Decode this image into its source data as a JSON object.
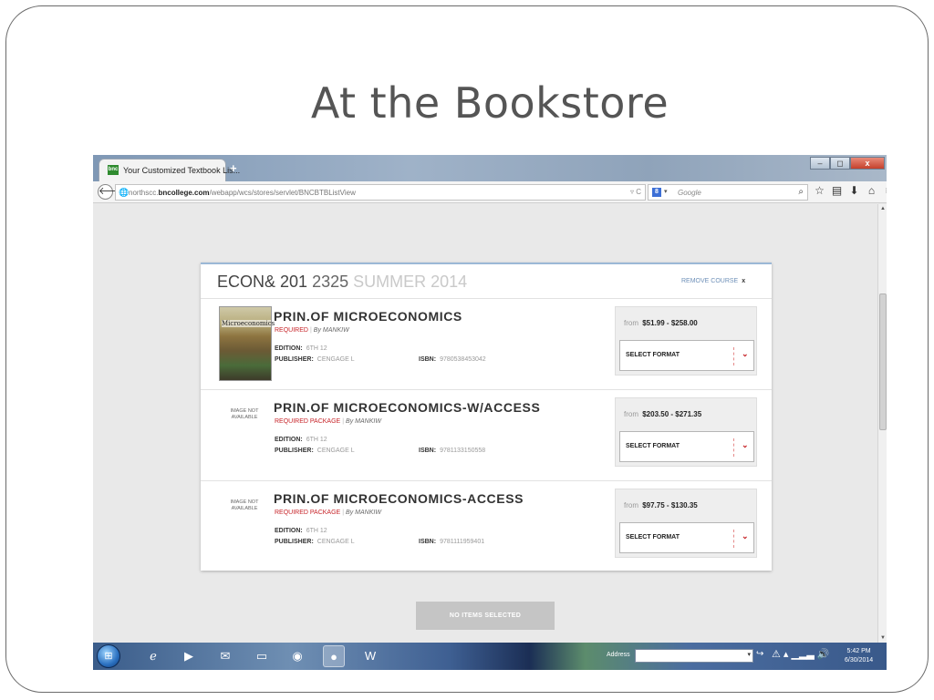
{
  "slide": {
    "title": "At the Bookstore"
  },
  "browser": {
    "tab_title": "Your Customized Textbook Lis...",
    "tab_favicon": "bnc",
    "new_tab": "+",
    "window_buttons": {
      "minimize": "–",
      "maximize": "◻",
      "close": "x"
    },
    "url_prefix": "northscc.",
    "url_domain": "bncollege.com",
    "url_path": "/webapp/wcs/stores/servlet/BNCBTBListView",
    "url_icons": "▿ C",
    "search_engine_icon": "8",
    "search_placeholder": "Google",
    "toolbar_icons": [
      "search-icon",
      "star-icon",
      "clipboard-icon",
      "download-icon",
      "home-icon",
      "menu-icon"
    ]
  },
  "course": {
    "name": "ECON& 201",
    "number": "2325",
    "term": "SUMMER 2014",
    "remove_label": "REMOVE COURSE",
    "remove_x": "x"
  },
  "books": [
    {
      "title": "PRIN.OF MICROECONOMICS",
      "requirement": "REQUIRED",
      "author": "By MANKIW",
      "edition_label": "EDITION:",
      "edition": "6TH 12",
      "publisher_label": "PUBLISHER:",
      "publisher": "CENGAGE L",
      "isbn_label": "ISBN:",
      "isbn": "9780538453042",
      "image": "Microeconomics",
      "price_from": "from",
      "price_range": "$51.99 - $258.00",
      "select_label": "SELECT FORMAT"
    },
    {
      "title": "PRIN.OF MICROECONOMICS-W/ACCESS",
      "requirement": "REQUIRED PACKAGE",
      "author": "By MANKIW",
      "edition_label": "EDITION:",
      "edition": "6TH 12",
      "publisher_label": "PUBLISHER:",
      "publisher": "CENGAGE L",
      "isbn_label": "ISBN:",
      "isbn": "9781133150558",
      "image": "IMAGE NOT AVAILABLE",
      "price_from": "from",
      "price_range": "$203.50 - $271.35",
      "select_label": "SELECT FORMAT"
    },
    {
      "title": "PRIN.OF MICROECONOMICS-ACCESS",
      "requirement": "REQUIRED PACKAGE",
      "author": "By MANKIW",
      "edition_label": "EDITION:",
      "edition": "6TH 12",
      "publisher_label": "PUBLISHER:",
      "publisher": "CENGAGE L",
      "isbn_label": "ISBN:",
      "isbn": "9781111959401",
      "image": "IMAGE NOT AVAILABLE",
      "price_from": "from",
      "price_range": "$97.75 - $130.35",
      "select_label": "SELECT FORMAT"
    }
  ],
  "no_items_button": "NO ITEMS SELECTED",
  "taskbar": {
    "address_label": "Address",
    "clock_time": "5:42 PM",
    "clock_date": "6/30/2014"
  }
}
